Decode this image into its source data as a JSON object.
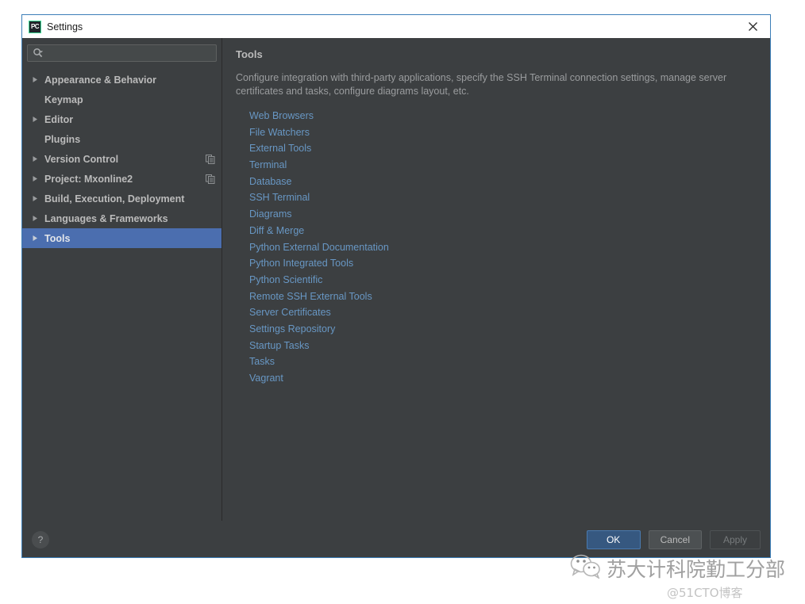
{
  "window": {
    "title": "Settings",
    "app_icon": "pycharm-icon",
    "app_icon_text": "PC",
    "close_label": "×",
    "accent_border": "#3c7eb8",
    "background": "#3c3f41"
  },
  "search": {
    "value": "",
    "placeholder": "",
    "icon": "search-icon"
  },
  "sidebar": {
    "items": [
      {
        "label": "Appearance & Behavior",
        "expandable": true,
        "selected": false,
        "trailing_icon": ""
      },
      {
        "label": "Keymap",
        "expandable": false,
        "selected": false,
        "trailing_icon": ""
      },
      {
        "label": "Editor",
        "expandable": true,
        "selected": false,
        "trailing_icon": ""
      },
      {
        "label": "Plugins",
        "expandable": false,
        "selected": false,
        "trailing_icon": ""
      },
      {
        "label": "Version Control",
        "expandable": true,
        "selected": false,
        "trailing_icon": "copy-document-icon"
      },
      {
        "label": "Project: Mxonline2",
        "expandable": true,
        "selected": false,
        "trailing_icon": "copy-document-icon"
      },
      {
        "label": "Build, Execution, Deployment",
        "expandable": true,
        "selected": false,
        "trailing_icon": ""
      },
      {
        "label": "Languages & Frameworks",
        "expandable": true,
        "selected": false,
        "trailing_icon": ""
      },
      {
        "label": "Tools",
        "expandable": true,
        "selected": true,
        "trailing_icon": ""
      }
    ],
    "selection_color": "#4b6eaf"
  },
  "main": {
    "title": "Tools",
    "description": "Configure integration with third-party applications, specify the SSH Terminal connection settings, manage server certificates and tasks, configure diagrams layout, etc.",
    "link_color": "#6897c4",
    "links": [
      "Web Browsers",
      "File Watchers",
      "External Tools",
      "Terminal",
      "Database",
      "SSH Terminal",
      "Diagrams",
      "Diff & Merge",
      "Python External Documentation",
      "Python Integrated Tools",
      "Python Scientific",
      "Remote SSH External Tools",
      "Server Certificates",
      "Settings Repository",
      "Startup Tasks",
      "Tasks",
      "Vagrant"
    ]
  },
  "footer": {
    "help_label": "?",
    "ok_label": "OK",
    "cancel_label": "Cancel",
    "apply_label": "Apply",
    "ok_color": "#365880"
  },
  "watermark": {
    "icon": "wechat-icon",
    "text": "苏大计科院勤工分部",
    "attribution": "@51CTO博客"
  }
}
